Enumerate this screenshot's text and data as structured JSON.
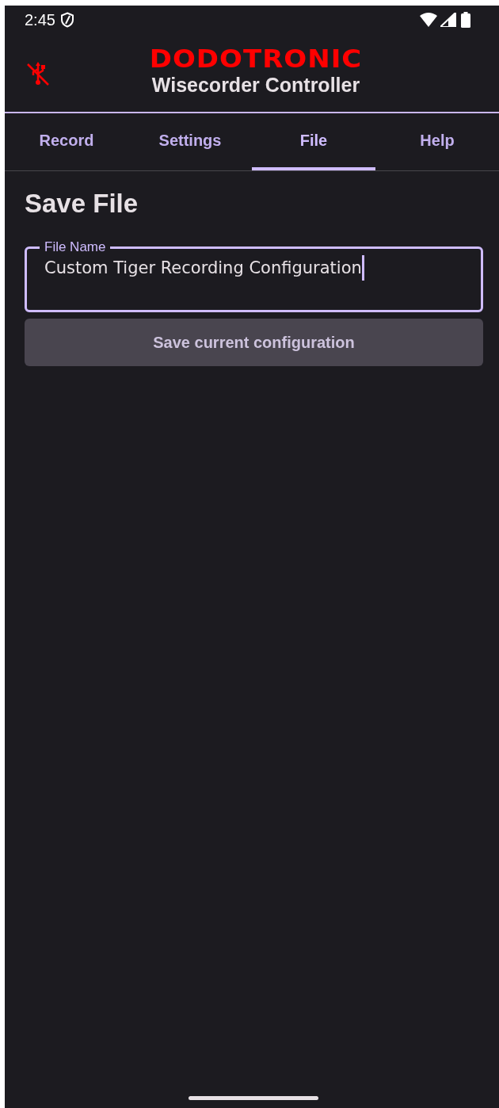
{
  "status_bar": {
    "time": "2:45"
  },
  "header": {
    "brand": "DODOTRONIC",
    "title": "Wisecorder Controller",
    "usb_connected": false
  },
  "tabs": [
    {
      "label": "Record",
      "selected": false
    },
    {
      "label": "Settings",
      "selected": false
    },
    {
      "label": "File",
      "selected": true
    },
    {
      "label": "Help",
      "selected": false
    }
  ],
  "section": {
    "title": "Save File"
  },
  "file_name_field": {
    "label": "File Name",
    "value": "Custom Tiger Recording Configuration",
    "focused": true
  },
  "save_button": {
    "label": "Save current configuration",
    "disabled": true
  }
}
